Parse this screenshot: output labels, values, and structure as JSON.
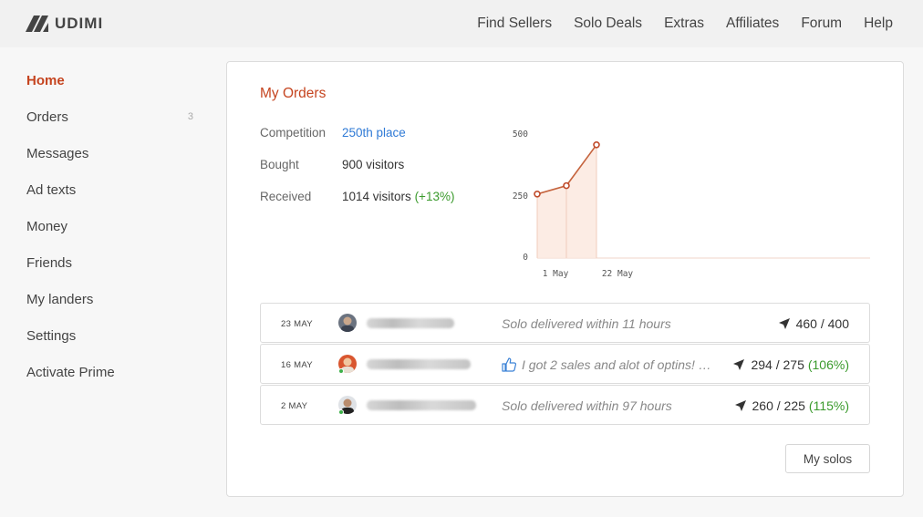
{
  "app": {
    "logo_text": "UDIMI"
  },
  "nav": [
    "Find Sellers",
    "Solo Deals",
    "Extras",
    "Affiliates",
    "Forum",
    "Help"
  ],
  "sidebar": {
    "items": [
      {
        "label": "Home",
        "active": true
      },
      {
        "label": "Orders",
        "count": "3"
      },
      {
        "label": "Messages"
      },
      {
        "label": "Ad texts"
      },
      {
        "label": "Money"
      },
      {
        "label": "Friends"
      },
      {
        "label": "My landers"
      },
      {
        "label": "Settings"
      },
      {
        "label": "Activate Prime"
      }
    ]
  },
  "orders_card": {
    "title": "My Orders",
    "competition_label": "Competition",
    "competition_value": "250th place",
    "bought_label": "Bought",
    "bought_value": "900 visitors",
    "received_label": "Received",
    "received_value": "1014 visitors",
    "received_extra": "(+13%)"
  },
  "chart_data": {
    "type": "area",
    "x": [
      "1 May",
      "16 May",
      "22 May"
    ],
    "values": [
      260,
      294,
      460
    ],
    "y_ticks": [
      "500",
      "250",
      "0"
    ],
    "x_tick_labels": [
      "1 May",
      "22 May"
    ],
    "ylim": [
      0,
      500
    ],
    "color": "#c5643e"
  },
  "orders": [
    {
      "date": "23 MAY",
      "review": "Solo delivered within 11 hours",
      "ratio": "460 / 400",
      "pct": "",
      "thumb": false,
      "online": false
    },
    {
      "date": "16 MAY",
      "review": "I got 2 sales and alot of optins! …",
      "ratio": "294 / 275",
      "pct": "(106%)",
      "thumb": true,
      "online": true
    },
    {
      "date": "2 MAY",
      "review": "Solo delivered within 97 hours",
      "ratio": "260 / 225",
      "pct": "(115%)",
      "thumb": false,
      "online": true
    }
  ],
  "my_solos_button": "My solos",
  "colors": {
    "accent": "#c5441f",
    "link": "#2f7ad6",
    "positive": "#3a9a2c"
  }
}
